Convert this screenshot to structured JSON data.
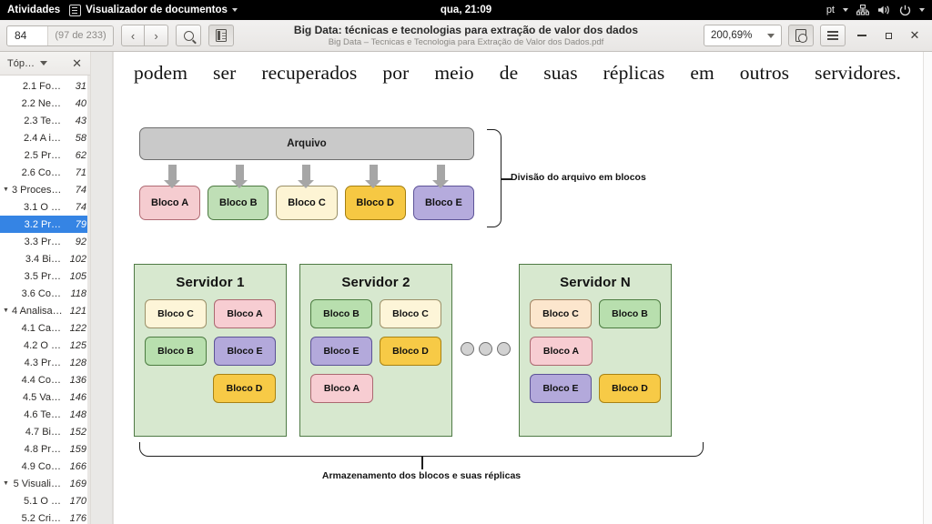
{
  "topbar": {
    "activities": "Atividades",
    "app_icon": "document-viewer-icon",
    "app_name": "Visualizador de documentos",
    "clock": "qua, 21:09",
    "language": "pt",
    "tray_icons": [
      "network-icon",
      "volume-icon",
      "power-icon"
    ]
  },
  "titlebar": {
    "page_current": "84",
    "page_total": "(97 de 233)",
    "prev_label": "‹",
    "next_label": "›",
    "search_icon": "search-icon",
    "sidebar_icon": "sidebar-toggle-icon",
    "title": "Big Data: técnicas e tecnologias para extração de valor dos dados",
    "subtitle": "Big Data – Tecnicas e Tecnologia para Extração de Valor dos Dados.pdf",
    "zoom_value": "200,69%",
    "page_fit_icon": "page-fit-icon",
    "menu_icon": "hamburger-menu-icon",
    "minimize_label": "–",
    "maximize_label": "▫",
    "close_label": "✕"
  },
  "sidebar": {
    "header_title": "Tóp…",
    "header_chevron": "chevron-down-icon",
    "close_icon": "close-icon",
    "selected_index": 8,
    "items": [
      {
        "label": "2.1 Fo…",
        "page": "31",
        "level": 2,
        "twisty": ""
      },
      {
        "label": "2.2 Ne…",
        "page": "40",
        "level": 2,
        "twisty": ""
      },
      {
        "label": "2.3 Te…",
        "page": "43",
        "level": 2,
        "twisty": ""
      },
      {
        "label": "2.4 A i…",
        "page": "58",
        "level": 2,
        "twisty": ""
      },
      {
        "label": "2.5 Pr…",
        "page": "62",
        "level": 2,
        "twisty": ""
      },
      {
        "label": "2.6 Co…",
        "page": "71",
        "level": 2,
        "twisty": ""
      },
      {
        "label": "3 Proces…",
        "page": "74",
        "level": 1,
        "twisty": "▼"
      },
      {
        "label": "3.1 O …",
        "page": "74",
        "level": 2,
        "twisty": ""
      },
      {
        "label": "3.2 Pr…",
        "page": "79",
        "level": 2,
        "twisty": ""
      },
      {
        "label": "3.3 Pr…",
        "page": "92",
        "level": 2,
        "twisty": ""
      },
      {
        "label": "3.4 Bi…",
        "page": "102",
        "level": 2,
        "twisty": ""
      },
      {
        "label": "3.5 Pr…",
        "page": "105",
        "level": 2,
        "twisty": ""
      },
      {
        "label": "3.6 Co…",
        "page": "118",
        "level": 2,
        "twisty": ""
      },
      {
        "label": "4 Analisa…",
        "page": "121",
        "level": 1,
        "twisty": "▼"
      },
      {
        "label": "4.1 Ca…",
        "page": "122",
        "level": 2,
        "twisty": ""
      },
      {
        "label": "4.2 O …",
        "page": "125",
        "level": 2,
        "twisty": ""
      },
      {
        "label": "4.3 Pr…",
        "page": "128",
        "level": 2,
        "twisty": ""
      },
      {
        "label": "4.4 Co…",
        "page": "136",
        "level": 2,
        "twisty": ""
      },
      {
        "label": "4.5 Va…",
        "page": "146",
        "level": 2,
        "twisty": ""
      },
      {
        "label": "4.6 Te…",
        "page": "148",
        "level": 2,
        "twisty": ""
      },
      {
        "label": "4.7 Bi…",
        "page": "152",
        "level": 2,
        "twisty": ""
      },
      {
        "label": "4.8 Pr…",
        "page": "159",
        "level": 2,
        "twisty": ""
      },
      {
        "label": "4.9 Co…",
        "page": "166",
        "level": 2,
        "twisty": ""
      },
      {
        "label": "5 Visuali…",
        "page": "169",
        "level": 1,
        "twisty": "▼"
      },
      {
        "label": "5.1 O …",
        "page": "170",
        "level": 2,
        "twisty": ""
      },
      {
        "label": "5.2 Cri…",
        "page": "176",
        "level": 2,
        "twisty": ""
      }
    ]
  },
  "document": {
    "paragraph": "podem ser recuperados por meio de suas réplicas em outros servidores.",
    "figure": {
      "file_box_label": "Arquivo",
      "top_blocks": [
        {
          "label": "Bloco A",
          "color_class": "a",
          "color": "#f5ccd0"
        },
        {
          "label": "Bloco B",
          "color_class": "b",
          "color": "#bfdfb6"
        },
        {
          "label": "Bloco C",
          "color_class": "c",
          "color": "#fdf4d4"
        },
        {
          "label": "Bloco D",
          "color_class": "d",
          "color": "#f6c843"
        },
        {
          "label": "Bloco E",
          "color_class": "e",
          "color": "#b5abdd"
        }
      ],
      "top_bracket_label": "Divisão do arquivo em blocos",
      "bottom_bracket_label": "Armazenamento dos blocos e suas réplicas",
      "ellipsis_dots": 3,
      "servers": [
        {
          "name": "Servidor 1",
          "rows": [
            [
              {
                "label": "Bloco C",
                "color_class": "c"
              },
              {
                "label": "Bloco A",
                "color_class": "a"
              }
            ],
            [
              {
                "label": "Bloco B",
                "color_class": "b"
              },
              {
                "label": "Bloco E",
                "color_class": "e"
              }
            ],
            [
              {
                "label": "",
                "color_class": "spacer"
              },
              {
                "label": "Bloco D",
                "color_class": "d"
              }
            ]
          ]
        },
        {
          "name": "Servidor 2",
          "rows": [
            [
              {
                "label": "Bloco B",
                "color_class": "b"
              },
              {
                "label": "Bloco C",
                "color_class": "c"
              }
            ],
            [
              {
                "label": "Bloco E",
                "color_class": "e"
              },
              {
                "label": "Bloco D",
                "color_class": "d"
              }
            ],
            [
              {
                "label": "Bloco A",
                "color_class": "a"
              },
              {
                "label": "",
                "color_class": "spacer"
              }
            ]
          ]
        },
        {
          "name": "Servidor N",
          "rows": [
            [
              {
                "label": "Bloco C",
                "color_class": "c2"
              },
              {
                "label": "Bloco B",
                "color_class": "b"
              }
            ],
            [
              {
                "label": "Bloco A",
                "color_class": "a"
              },
              {
                "label": "",
                "color_class": "spacer"
              }
            ],
            [
              {
                "label": "Bloco E",
                "color_class": "e"
              },
              {
                "label": "Bloco D",
                "color_class": "d"
              }
            ]
          ]
        }
      ]
    }
  },
  "colors": {
    "selection": "#3584e4",
    "server_bg": "#d7e8cf",
    "server_border": "#4f7a45",
    "file_box": "#c9c9c9"
  }
}
